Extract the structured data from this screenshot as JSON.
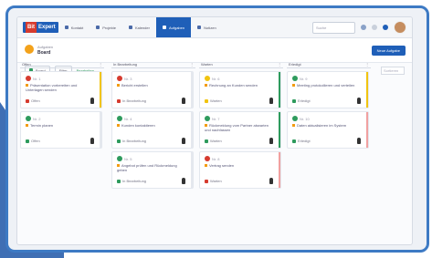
{
  "nav": {
    "logo_prefix": "Bit",
    "logo_text": "Expert",
    "tabs": [
      {
        "label": "Kontakt"
      },
      {
        "label": "Projekte"
      },
      {
        "label": "Kalender"
      },
      {
        "label": "Aufgaben",
        "active": true
      },
      {
        "label": "Notizen"
      }
    ],
    "search_placeholder": "Suche"
  },
  "header": {
    "breadcrumb": "Aufgaben",
    "title": "Board",
    "create_label": "Neue Aufgabe"
  },
  "toolbar": {
    "view_label": "Board",
    "filter_label": "Filter",
    "filter_link": "Bearbeiten",
    "right_label": "Sortieren"
  },
  "colors": {
    "primary": "#1f5fb8",
    "accent_orange": "#f3a21b",
    "green": "#2e9b5d",
    "red": "#d63b2f",
    "yellow": "#f1c40f"
  },
  "columns": [
    {
      "title": "Offen",
      "cards": [
        {
          "num": "Nr. 1",
          "title": "Präsentation vorbereiten und Unterlagen senden",
          "status": "Offen",
          "bar": "#f1c40f",
          "icon": "#d63b2f"
        },
        {
          "num": "Nr. 2",
          "title": "Termin planen",
          "status": "Offen",
          "bar": "#e5e8ee",
          "icon": "#2e9b5d"
        }
      ]
    },
    {
      "title": "In Bearbeitung",
      "cards": [
        {
          "num": "Nr. 3",
          "title": "Bericht erstellen",
          "status": "In Bearbeitung",
          "bar": "#e5e8ee",
          "icon": "#d63b2f"
        },
        {
          "num": "Nr. 4",
          "title": "Kunden kontaktieren",
          "status": "In Bearbeitung",
          "bar": "#e5e8ee",
          "icon": "#2e9b5d"
        },
        {
          "num": "Nr. 5",
          "title": "Angebot prüfen und Rückmeldung geben",
          "status": "In Bearbeitung",
          "bar": "#e5e8ee",
          "icon": "#2e9b5d"
        }
      ]
    },
    {
      "title": "Warten",
      "cards": [
        {
          "num": "Nr. 6",
          "title": "Rechnung an Kunden senden",
          "status": "Warten",
          "bar": "#2e9b5d",
          "icon": "#f1c40f"
        },
        {
          "num": "Nr. 7",
          "title": "Rückmeldung vom Partner abwarten und nachfassen",
          "status": "Warten",
          "bar": "#2e9b5d",
          "icon": "#2e9b5d"
        },
        {
          "num": "Nr. 8",
          "title": "Vertrag senden",
          "status": "Warten",
          "bar": "#f1a0a0",
          "icon": "#d63b2f"
        }
      ]
    },
    {
      "title": "Erledigt",
      "cards": [
        {
          "num": "Nr. 9",
          "title": "Meeting protokollieren und verteilen",
          "status": "Erledigt",
          "bar": "#f1c40f",
          "icon": "#2e9b5d"
        },
        {
          "num": "Nr. 10",
          "title": "Daten aktualisieren im System",
          "status": "Erledigt",
          "bar": "#f1a0a0",
          "icon": "#2e9b5d"
        }
      ]
    }
  ]
}
